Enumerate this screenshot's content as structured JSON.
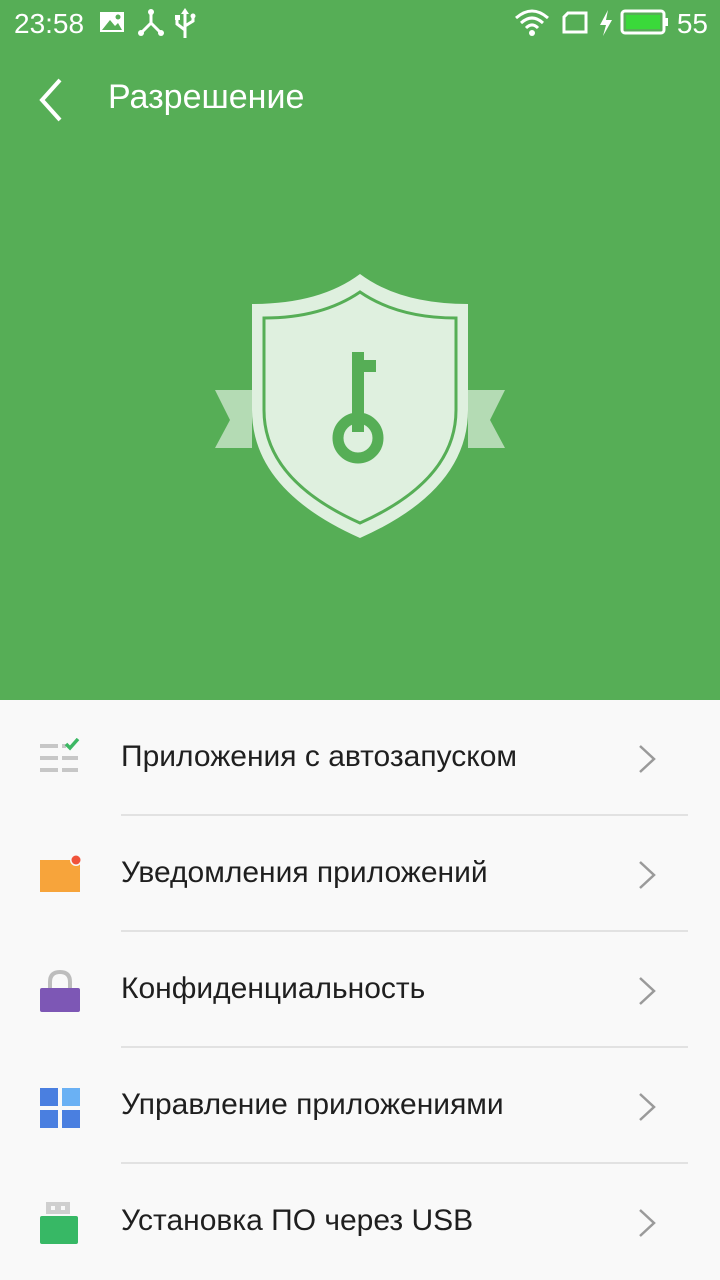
{
  "status_bar": {
    "time": "23:58",
    "battery": "55",
    "icons": [
      "image-icon",
      "network-share-icon",
      "usb-icon",
      "wifi-icon",
      "sim-icon",
      "charging-icon",
      "battery-icon"
    ]
  },
  "toolbar": {
    "title": "Разрешение",
    "back_icon": "back-arrow-icon"
  },
  "hero": {
    "icon": "shield-key-icon"
  },
  "colors": {
    "header_bg": "#56ae56",
    "list_bg": "#f9f9f9",
    "text": "#1f1f1f",
    "chevron": "#9a9a9a"
  },
  "menu": [
    {
      "label": "Приложения с автозапуском",
      "icon": "autostart-list-icon"
    },
    {
      "label": "Уведомления приложений",
      "icon": "notification-icon"
    },
    {
      "label": "Конфиденциальность",
      "icon": "lock-icon"
    },
    {
      "label": "Управление приложениями",
      "icon": "app-grid-icon"
    },
    {
      "label": "Установка ПО через USB",
      "icon": "usb-drive-icon"
    }
  ]
}
